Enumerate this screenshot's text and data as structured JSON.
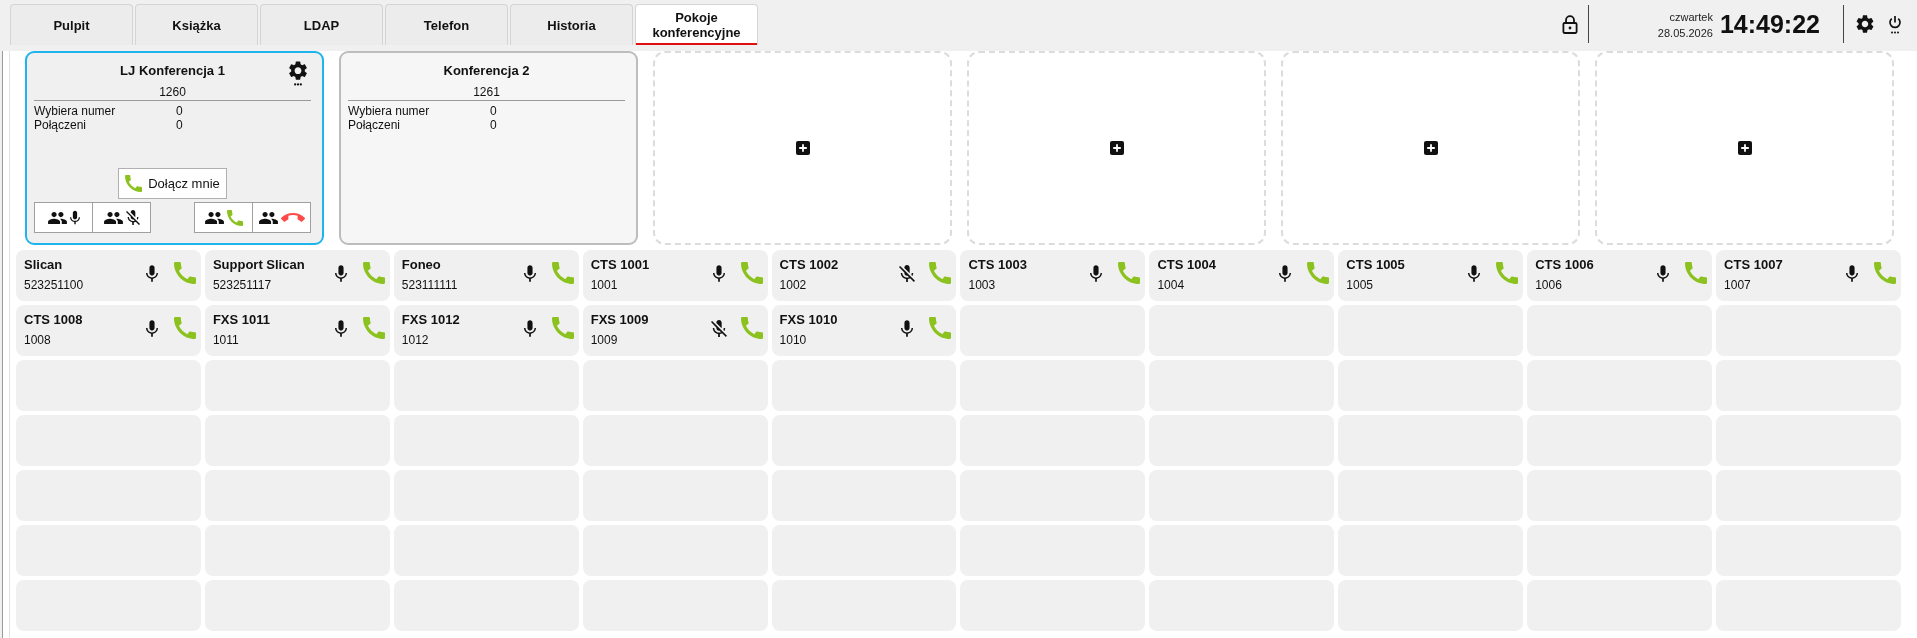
{
  "tabs": [
    {
      "label": "Pulpit",
      "selected": false
    },
    {
      "label": "Książka",
      "selected": false
    },
    {
      "label": "LDAP",
      "selected": false
    },
    {
      "label": "Telefon",
      "selected": false
    },
    {
      "label": "Historia",
      "selected": false
    },
    {
      "label": "Pokoje konferencyjne",
      "selected": true
    }
  ],
  "clock": {
    "day": "czwartek",
    "date": "28.05.2026",
    "time": "14:49:22"
  },
  "conference_rooms": [
    {
      "kind": "room",
      "title": "LJ Konferencja 1",
      "number": "1260",
      "selected": true,
      "stats": [
        {
          "label": "Wybiera numer",
          "value": "0"
        },
        {
          "label": "Połączeni",
          "value": "0"
        }
      ],
      "join_button": "Dołącz mnie",
      "actions": [
        {
          "kind": "unmute-all"
        },
        {
          "kind": "mute-all"
        },
        {
          "kind": "call-all"
        },
        {
          "kind": "hangup-all"
        }
      ]
    },
    {
      "kind": "room",
      "title": "Konferencja 2",
      "number": "1261",
      "selected": false,
      "stats": [
        {
          "label": "Wybiera numer",
          "value": "0"
        },
        {
          "label": "Połączeni",
          "value": "0"
        }
      ]
    },
    {
      "kind": "empty"
    },
    {
      "kind": "empty"
    },
    {
      "kind": "empty"
    },
    {
      "kind": "empty"
    }
  ],
  "participants": [
    {
      "name": "Slican",
      "number": "523251100",
      "muted": false
    },
    {
      "name": "Support Slican",
      "number": "523251117",
      "muted": false
    },
    {
      "name": "Foneo",
      "number": "523111111",
      "muted": false
    },
    {
      "name": "CTS 1001",
      "number": "1001",
      "muted": false
    },
    {
      "name": "CTS 1002",
      "number": "1002",
      "muted": true
    },
    {
      "name": "CTS 1003",
      "number": "1003",
      "muted": false
    },
    {
      "name": "CTS 1004",
      "number": "1004",
      "muted": false
    },
    {
      "name": "CTS 1005",
      "number": "1005",
      "muted": false
    },
    {
      "name": "CTS 1006",
      "number": "1006",
      "muted": false
    },
    {
      "name": "CTS 1007",
      "number": "1007",
      "muted": false
    },
    {
      "name": "CTS 1008",
      "number": "1008",
      "muted": false
    },
    {
      "name": "FXS 1011",
      "number": "1011",
      "muted": false
    },
    {
      "name": "FXS 1012",
      "number": "1012",
      "muted": false
    },
    {
      "name": "FXS 1009",
      "number": "1009",
      "muted": true
    },
    {
      "name": "FXS 1010",
      "number": "1010",
      "muted": false
    }
  ]
}
